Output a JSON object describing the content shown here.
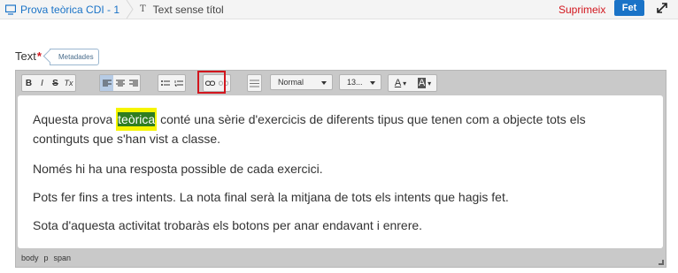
{
  "header": {
    "breadcrumb_1": "Prova teòrica CDI - 1",
    "breadcrumb_2": "Text sense títol",
    "delete_label": "Suprimeix",
    "done_label": "Fet"
  },
  "field": {
    "label": "Text",
    "required_marker": "*",
    "metadata_tag": "Metadades"
  },
  "toolbar": {
    "bold": "B",
    "italic": "I",
    "strike": "S",
    "clear_format": "Tx",
    "format_select": "Normal",
    "size_select": "13...",
    "text_color": "A",
    "bg_color": "A"
  },
  "content": {
    "p1_before": "Aquesta prova ",
    "p1_highlight": "teòrica",
    "p1_after": " conté una sèrie d'exercicis de diferents tipus que tenen com a objecte tots els continguts que s'han vist a classe.",
    "p2": "Només hi ha una resposta possible de cada exercici.",
    "p3": "Pots fer fins a tres intents. La nota final serà la mitjana de tots els intents que hagis fet.",
    "p4": "Sota d'aquesta activitat trobaràs els botons per anar endavant i enrere."
  },
  "statusbar": {
    "path": [
      "body",
      "p",
      "span"
    ]
  },
  "colors": {
    "accent": "#1a73c7",
    "danger": "#d2161e",
    "highlight_bg": "#f6f500",
    "highlight_text_bg": "#2f7d21"
  }
}
